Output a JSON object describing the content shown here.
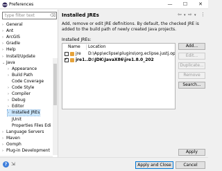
{
  "window": {
    "title": "Preferences",
    "minimize": "—",
    "maximize": "☐",
    "close": "✕"
  },
  "filter": {
    "placeholder": "type filter text"
  },
  "tree": [
    {
      "label": "General",
      "chev": "›"
    },
    {
      "label": "Ant",
      "chev": "›"
    },
    {
      "label": "ArcGIS",
      "chev": "›"
    },
    {
      "label": "Gradle",
      "chev": "›"
    },
    {
      "label": "Help",
      "chev": "›"
    },
    {
      "label": "Install/Update",
      "chev": "›"
    },
    {
      "label": "Java",
      "chev": "⌄"
    },
    {
      "label": "Appearance",
      "chev": "›"
    },
    {
      "label": "Build Path",
      "chev": "›"
    },
    {
      "label": "Code Coverage",
      "chev": ""
    },
    {
      "label": "Code Style",
      "chev": "›"
    },
    {
      "label": "Compiler",
      "chev": "›"
    },
    {
      "label": "Debug",
      "chev": "›"
    },
    {
      "label": "Editor",
      "chev": "›"
    },
    {
      "label": "Installed JREs",
      "chev": "›"
    },
    {
      "label": "JUnit",
      "chev": ""
    },
    {
      "label": "Properties Files Edi",
      "chev": ""
    },
    {
      "label": "Language Servers",
      "chev": "›"
    },
    {
      "label": "Maven",
      "chev": "›"
    },
    {
      "label": "Oomph",
      "chev": "›"
    },
    {
      "label": "Plug-in Development",
      "chev": "›"
    }
  ],
  "page": {
    "title": "Installed JREs",
    "description": "Add, remove or edit JRE definitions. By default, the checked JRE is added to the build path of newly created Java projects.",
    "installed_label": "Installed JREs:",
    "columns": {
      "name": "Name",
      "location": "Location"
    },
    "rows": [
      {
        "name": "jre",
        "location": "D:\\App\\eclipse\\plugins\\org.eclipse.justj.openjdk.h",
        "checked": false
      },
      {
        "name": "jre1...",
        "location": "D:\\JDK\\JavaX86\\jre1.8.0_202",
        "checked": true
      }
    ],
    "buttons": {
      "add": "Add...",
      "edit": "Edit...",
      "duplicate": "Duplicate...",
      "remove": "Remove",
      "search": "Search..."
    },
    "nav": {
      "back": "⇦",
      "back_menu": "▾",
      "forward": "⇨",
      "forward_menu": "▾",
      "menu": "⋮"
    }
  },
  "footer": {
    "apply": "Apply",
    "apply_close": "Apply and Close",
    "cancel": "Cancel",
    "help_glyph": "?",
    "export_glyph": "⇲"
  },
  "colors": {
    "selection": "#cce8ff",
    "accent": "#0078d7"
  }
}
